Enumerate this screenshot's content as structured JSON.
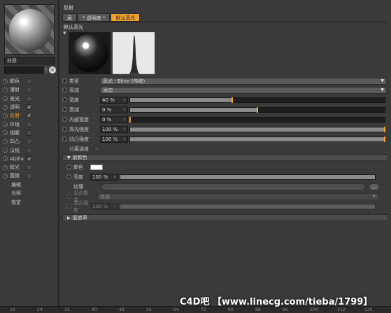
{
  "material_panel": {
    "material_name": "材质",
    "channels": [
      {
        "name": "颜色",
        "checked": false,
        "active": false
      },
      {
        "name": "漫射",
        "checked": false,
        "active": false
      },
      {
        "name": "发光",
        "checked": false,
        "active": false
      },
      {
        "name": "透明",
        "checked": true,
        "active": false
      },
      {
        "name": "反射",
        "checked": true,
        "active": true
      },
      {
        "name": "环境",
        "checked": false,
        "active": false
      },
      {
        "name": "烟雾",
        "checked": false,
        "active": false
      },
      {
        "name": "凹凸",
        "checked": false,
        "active": false
      },
      {
        "name": "法线",
        "checked": false,
        "active": false
      },
      {
        "name": "Alpha",
        "checked": true,
        "active": false
      },
      {
        "name": "辉光",
        "checked": false,
        "active": false
      },
      {
        "name": "置换",
        "checked": false,
        "active": false
      }
    ],
    "extra_items": [
      "编辑",
      "光照",
      "指定"
    ]
  },
  "reflection": {
    "title": "反射",
    "tabs": [
      {
        "label": "层",
        "selected": false
      },
      {
        "label": "* 透明度 *",
        "selected": false
      },
      {
        "label": "默认高光",
        "selected": true
      }
    ],
    "layer_label": "默认高光",
    "type": {
      "label": "类型",
      "value": "高光 - Blinn (传统)"
    },
    "falloff": {
      "label": "衰减",
      "value": "添加"
    },
    "params": [
      {
        "label": "宽度",
        "value": "40 %",
        "fraction": 0.4
      },
      {
        "label": "衰减",
        "value": "0 %",
        "fraction": 0.5
      },
      {
        "label": "内部宽度",
        "value": "0 %",
        "fraction": 0.0
      },
      {
        "label": "高光强度",
        "value": "100 %",
        "fraction": 1.0
      },
      {
        "label": "凹凸强度",
        "value": "100 %",
        "fraction": 1.0
      }
    ],
    "separate_pass": "分离通道"
  },
  "layer_color": {
    "section_title": "层颜色",
    "color_label": "颜色",
    "color_hex": "#ffffff",
    "brightness_label": "亮度",
    "brightness_value": "100 %",
    "brightness_fraction": 1.0,
    "texture_label": "纹理",
    "texture_button": "...",
    "blend_mode_label": "混合模式",
    "blend_mode_value": "普通",
    "blend_strength_label": "混合强度",
    "blend_strength_value": "100 %"
  },
  "mask_section": "层遮罩",
  "ruler_ticks": [
    "16",
    "24",
    "32",
    "40",
    "48",
    "56",
    "64",
    "72",
    "80",
    "88",
    "96",
    "104",
    "112",
    "120"
  ],
  "watermark": "C4D吧  【www.linecg.com/tieba/1799】",
  "colors": {
    "accent": "#f0a030",
    "panel": "#3a3a3a"
  }
}
